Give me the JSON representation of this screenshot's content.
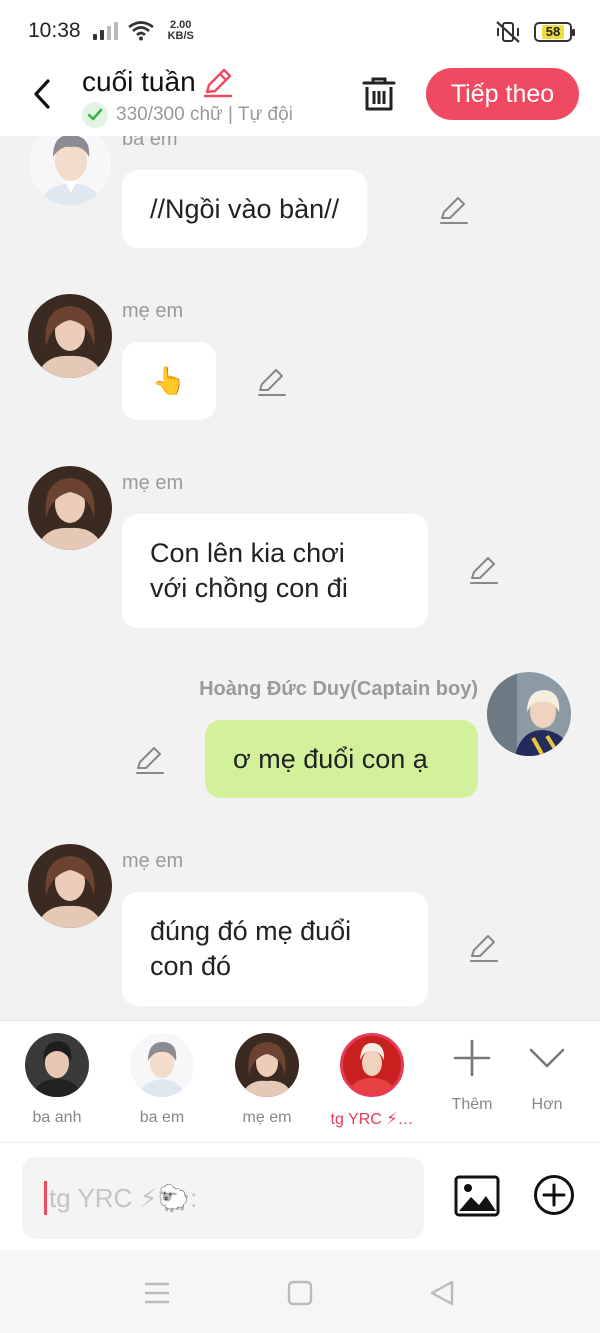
{
  "status_bar": {
    "time": "10:38",
    "speed_value": "2.00",
    "speed_unit": "KB/S",
    "battery": "58"
  },
  "header": {
    "title": "cuối tuần",
    "subtitle": "330/300 chữ | Tự đội",
    "next_label": "Tiếp theo",
    "icons": [
      "back-arrow-icon",
      "pencil-icon",
      "check-icon",
      "trash-icon"
    ],
    "colors": {
      "accent": "#f04a63",
      "my_bubble": "#d3f19b",
      "check": "#3ab54a"
    }
  },
  "messages": [
    {
      "sender": "ba em",
      "text": "//Ngồi vào bàn//",
      "side": "left"
    },
    {
      "sender": "mẹ em",
      "text": "👆",
      "side": "left"
    },
    {
      "sender": "mẹ em",
      "text": "Con lên kia chơi\nvới chồng con đi",
      "side": "left"
    },
    {
      "sender": "Hoàng Đức Duy(Captain boy)",
      "text": "ơ mẹ đuổi con ạ",
      "side": "right"
    },
    {
      "sender": "mẹ em",
      "text": "đúng đó mẹ đuổi\ncon đó",
      "side": "left"
    }
  ],
  "characters": [
    {
      "label": "ba anh"
    },
    {
      "label": "ba em"
    },
    {
      "label": "mẹ em"
    },
    {
      "label": "tg YRC ⚡…",
      "selected": true
    }
  ],
  "char_actions": {
    "more": "Thêm",
    "collapse": "Hơn"
  },
  "composer": {
    "placeholder": "tg YRC ⚡🐑:"
  },
  "nav_icons": [
    "menu-icon",
    "home-icon",
    "back-icon"
  ]
}
